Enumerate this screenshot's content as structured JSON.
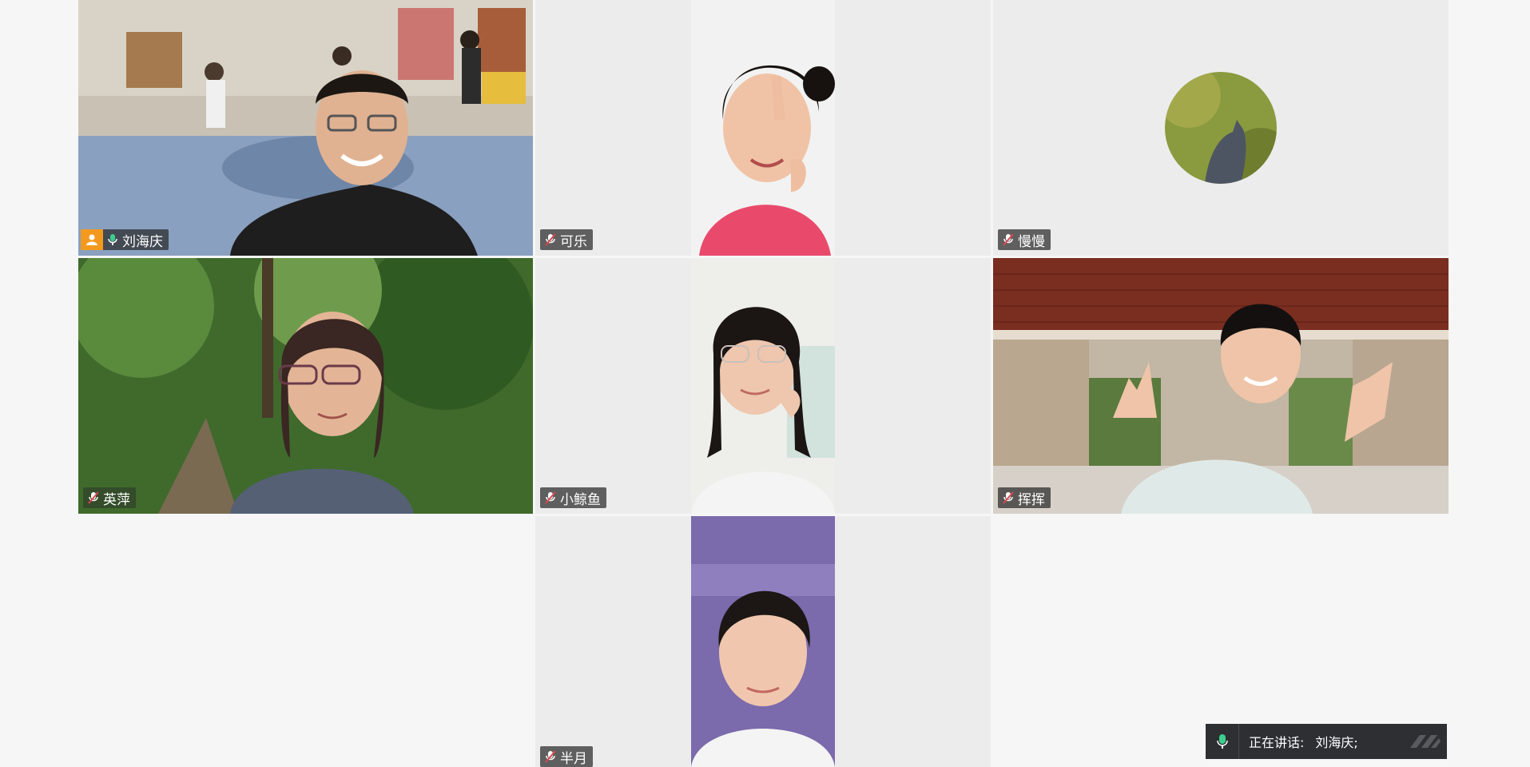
{
  "participants": [
    {
      "name": "刘海庆",
      "host": true,
      "speaking": true,
      "mic": "on"
    },
    {
      "name": "可乐",
      "mic": "muted"
    },
    {
      "name": "慢慢",
      "mic": "muted"
    },
    {
      "name": "英萍",
      "mic": "muted"
    },
    {
      "name": "小鲸鱼",
      "mic": "muted"
    },
    {
      "name": "挥挥",
      "mic": "muted"
    },
    {
      "name": "半月",
      "mic": "muted"
    }
  ],
  "speaker_bar": {
    "label": "正在讲话:",
    "name": "刘海庆;"
  },
  "colors": {
    "active_border": "#3ccf8e",
    "host_badge": "#f39a1e",
    "speaker_bar_bg": "#2e2f33",
    "mic_green": "#3ccf8e",
    "mic_muted": "#e0444e"
  },
  "icons": [
    "user-icon",
    "mic-icon",
    "mic-muted-icon",
    "drag-handle-icon"
  ]
}
